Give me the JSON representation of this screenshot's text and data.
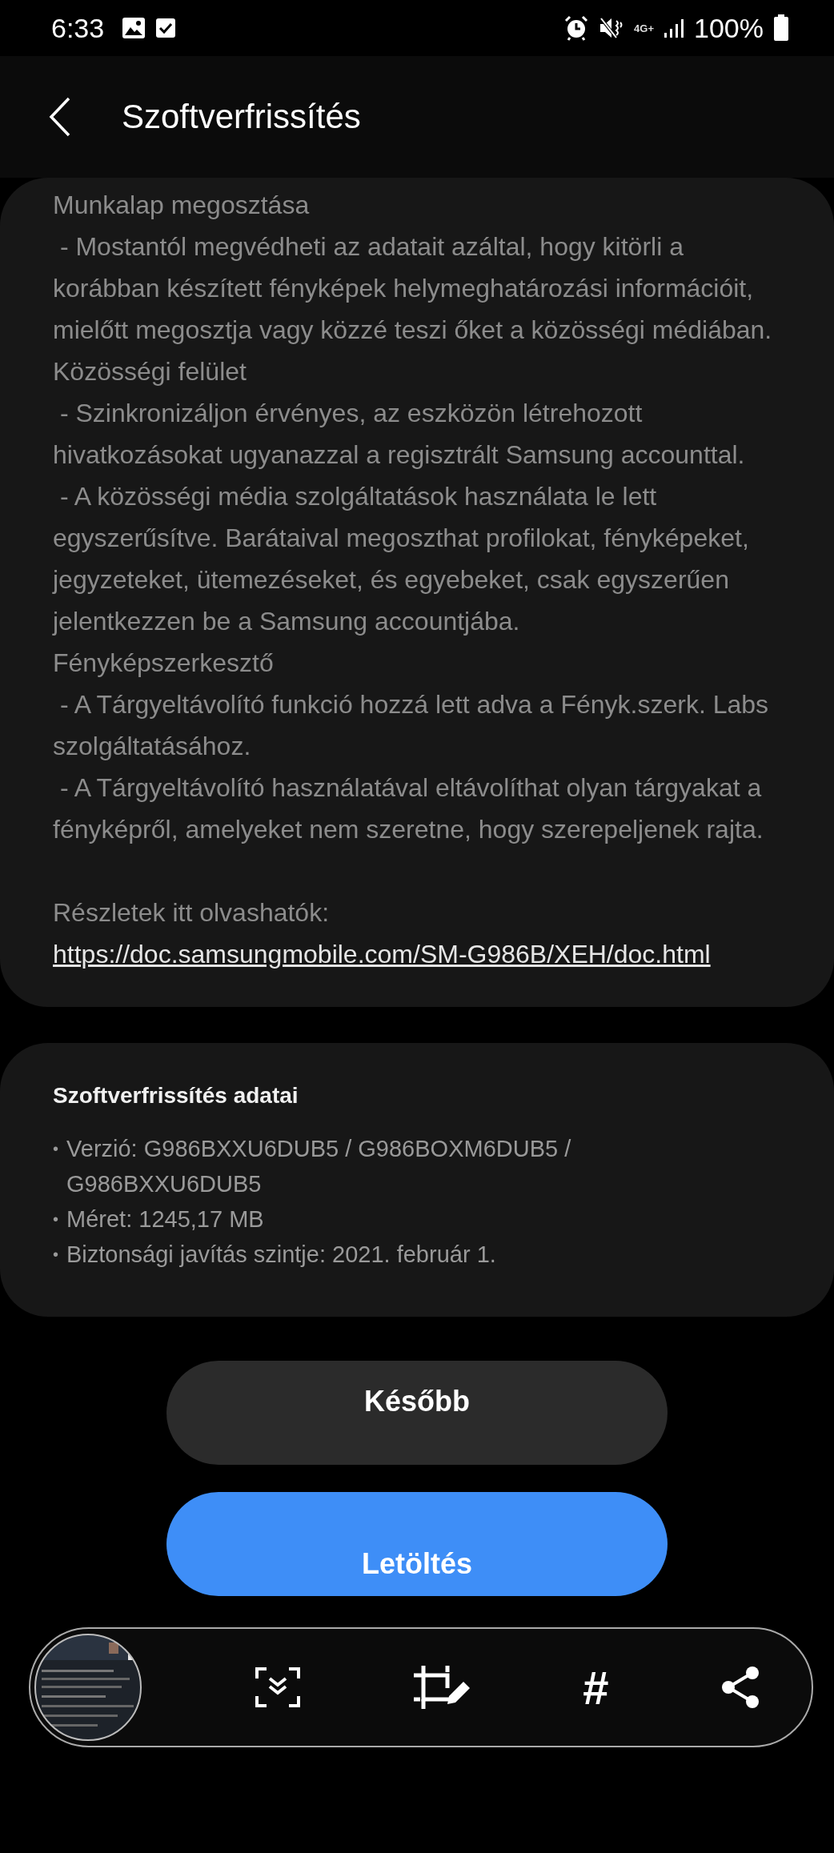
{
  "status_bar": {
    "time": "6:33",
    "network": "4G+",
    "battery": "100%"
  },
  "header": {
    "title": "Szoftverfrissítés"
  },
  "notes": {
    "paragraphs": [
      "Munkalap megosztása",
      " - Mostantól megvédheti az adatait azáltal, hogy kitörli a korábban készített fényképek helymeghatározási információit, mielőtt megosztja vagy közzé teszi őket a közösségi médiában.",
      "Közösségi felület",
      " - Szinkronizáljon érvényes, az eszközön létrehozott hivatkozásokat ugyanazzal a regisztrált Samsung accounttal.",
      " - A közösségi média szolgáltatások használata le lett egyszerűsítve. Barátaival megoszthat profilokat, fényképeket, jegyzeteket, ütemezéseket, és egyebeket, csak egyszerűen jelentkezzen be a Samsung accountjába.",
      "Fényképszerkesztő",
      " - A Tárgyeltávolító funkció hozzá lett adva a Fényk.szerk. Labs szolgáltatásához.",
      " - A Tárgyeltávolító használatával eltávolíthat olyan tárgyakat a fényképről, amelyeket nem szeretne, hogy szerepeljenek rajta."
    ],
    "details_label": "Részletek itt olvashatók:",
    "link": "https://doc.samsungmobile.com/SM-G986B/XEH/doc.html"
  },
  "details": {
    "title": "Szoftverfrissítés adatai",
    "items": [
      {
        "bullet": "•",
        "text": "Verzió: G986BXXU6DUB5 / G986BOXM6DUB5 / G986BXXU6DUB5"
      },
      {
        "bullet": "•",
        "text": "Méret: 1245,17 MB"
      },
      {
        "bullet": "•",
        "text": "Biztonsági javítás szintje: 2021. február 1."
      }
    ]
  },
  "buttons": [
    {
      "label": "Később",
      "kind": "secondary"
    },
    {
      "label": "Letöltés",
      "kind": "primary"
    }
  ],
  "capture_toolbar": {
    "tag_label": "#"
  }
}
